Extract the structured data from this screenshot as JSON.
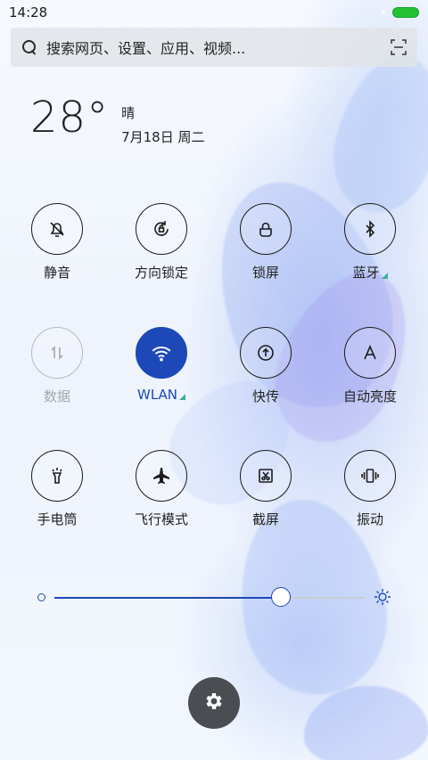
{
  "status_bar": {
    "time": "14:28",
    "battery_color": "#22c232"
  },
  "search": {
    "placeholder": "搜索网页、设置、应用、视频..."
  },
  "weather": {
    "temperature": "28°",
    "condition": "晴",
    "date": "7月18日 周二"
  },
  "tiles": [
    {
      "id": "mute",
      "label": "静音",
      "icon": "bell-off-icon",
      "state": "off"
    },
    {
      "id": "rotation-lock",
      "label": "方向锁定",
      "icon": "rotation-lock-icon",
      "state": "off"
    },
    {
      "id": "lock-screen",
      "label": "锁屏",
      "icon": "lock-icon",
      "state": "off"
    },
    {
      "id": "bluetooth",
      "label": "蓝牙",
      "icon": "bluetooth-icon",
      "state": "off",
      "has_more": true
    },
    {
      "id": "data",
      "label": "数据",
      "icon": "data-arrows-icon",
      "state": "disabled"
    },
    {
      "id": "wlan",
      "label": "WLAN",
      "icon": "wifi-icon",
      "state": "active",
      "has_more": true
    },
    {
      "id": "quick-share",
      "label": "快传",
      "icon": "upload-arrow-icon",
      "state": "off"
    },
    {
      "id": "auto-brightness",
      "label": "自动亮度",
      "icon": "auto-brightness-icon",
      "state": "off"
    },
    {
      "id": "flashlight",
      "label": "手电筒",
      "icon": "flashlight-icon",
      "state": "off"
    },
    {
      "id": "airplane",
      "label": "飞行模式",
      "icon": "airplane-icon",
      "state": "off"
    },
    {
      "id": "screenshot",
      "label": "截屏",
      "icon": "scissors-icon",
      "state": "off"
    },
    {
      "id": "vibrate",
      "label": "振动",
      "icon": "vibrate-icon",
      "state": "off"
    }
  ],
  "brightness": {
    "level": 0.73,
    "min_icon": "brightness-low-icon",
    "max_icon": "brightness-high-icon"
  },
  "settings_button": {
    "icon": "gear-icon"
  },
  "colors": {
    "accent": "#1c48b8",
    "tile_border": "#1c1c1c",
    "disabled": "#b5b9bf",
    "triangle": "#3bb0a0"
  }
}
